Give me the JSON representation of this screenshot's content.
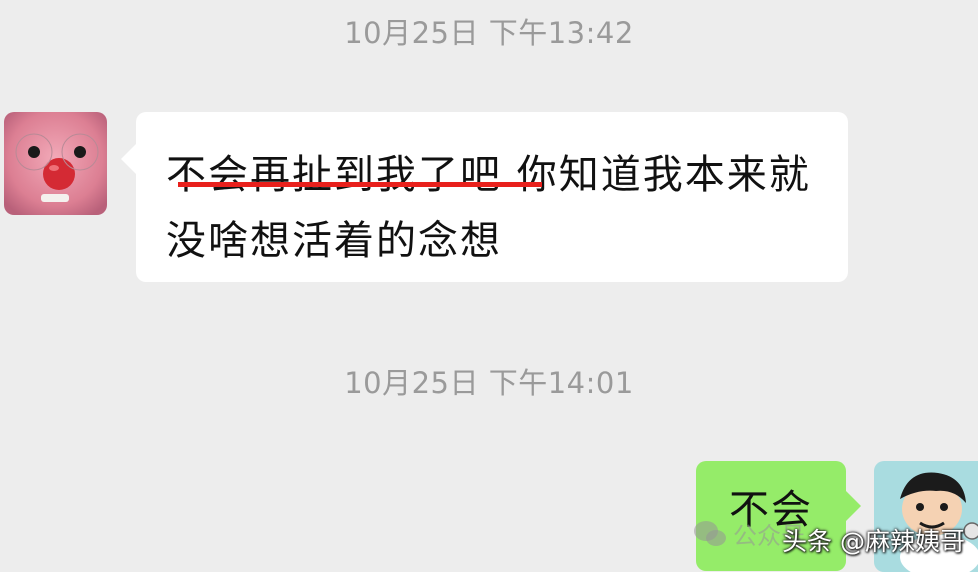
{
  "timestamps": {
    "first": "10月25日 下午13:42",
    "second": "10月25日 下午14:01"
  },
  "incoming_message": {
    "avatar": "pink-plush-avatar",
    "highlighted_text": "不会再扯到我了吧",
    "rest_text": " 你知道我本来就没啥想活着的念想",
    "underline_color": "#e8201c"
  },
  "outgoing_message": {
    "avatar": "cartoon-boy-avatar",
    "text": "不会"
  },
  "watermarks": {
    "wechat_text": "公众号",
    "toutiao_text": "头条 @麻辣姨哥"
  },
  "colors": {
    "background": "#ededed",
    "incoming_bubble": "#ffffff",
    "outgoing_bubble": "#95ec69",
    "timestamp": "#9a9a9a"
  }
}
